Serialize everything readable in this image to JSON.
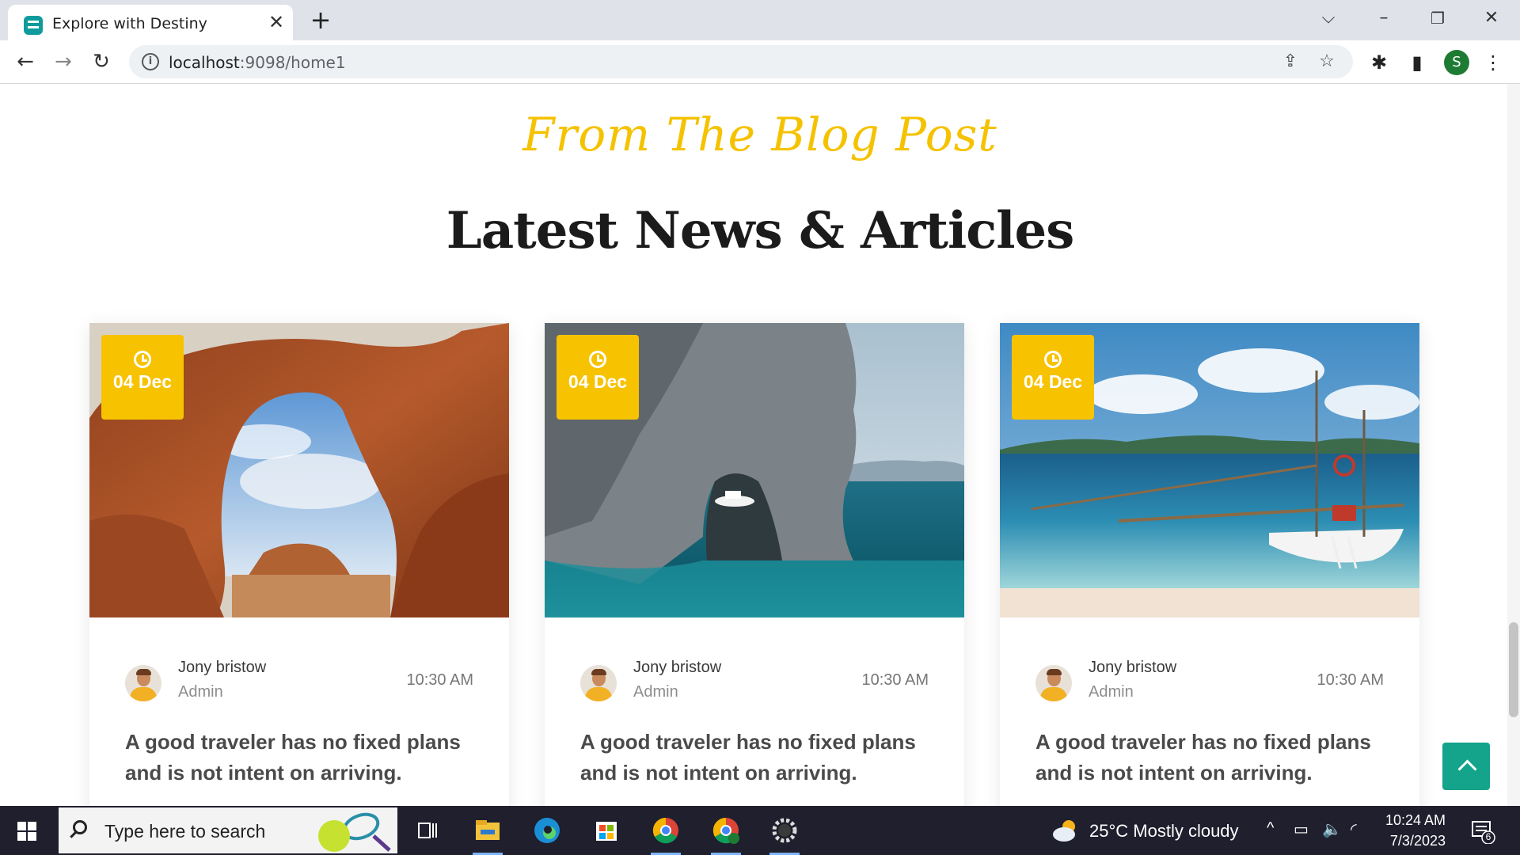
{
  "browser": {
    "tab_title": "Explore with Destiny",
    "url_host": "localhost",
    "url_rest": ":9098/home1",
    "profile_initial": "S"
  },
  "section": {
    "script_title": "From The Blog Post",
    "title": "Latest News & Articles"
  },
  "cards": [
    {
      "date": "04 Dec",
      "author": "Jony bristow",
      "role": "Admin",
      "time": "10:30 AM",
      "title": "A good traveler has no fixed plans and is not intent on arriving.",
      "image": "desert-arch-photo"
    },
    {
      "date": "04 Dec",
      "author": "Jony bristow",
      "role": "Admin",
      "time": "10:30 AM",
      "title": "A good traveler has no fixed plans and is not intent on arriving.",
      "image": "sea-cave-photo"
    },
    {
      "date": "04 Dec",
      "author": "Jony bristow",
      "role": "Admin",
      "time": "10:30 AM",
      "title": "A good traveler has no fixed plans and is not intent on arriving.",
      "image": "beach-boat-photo"
    }
  ],
  "taskbar": {
    "search_placeholder": "Type here to search",
    "weather": "25°C  Mostly cloudy",
    "time": "10:24 AM",
    "date": "7/3/2023",
    "notification_count": "6"
  },
  "colors": {
    "accent_yellow": "#f7c200",
    "teal": "#14a38b"
  }
}
